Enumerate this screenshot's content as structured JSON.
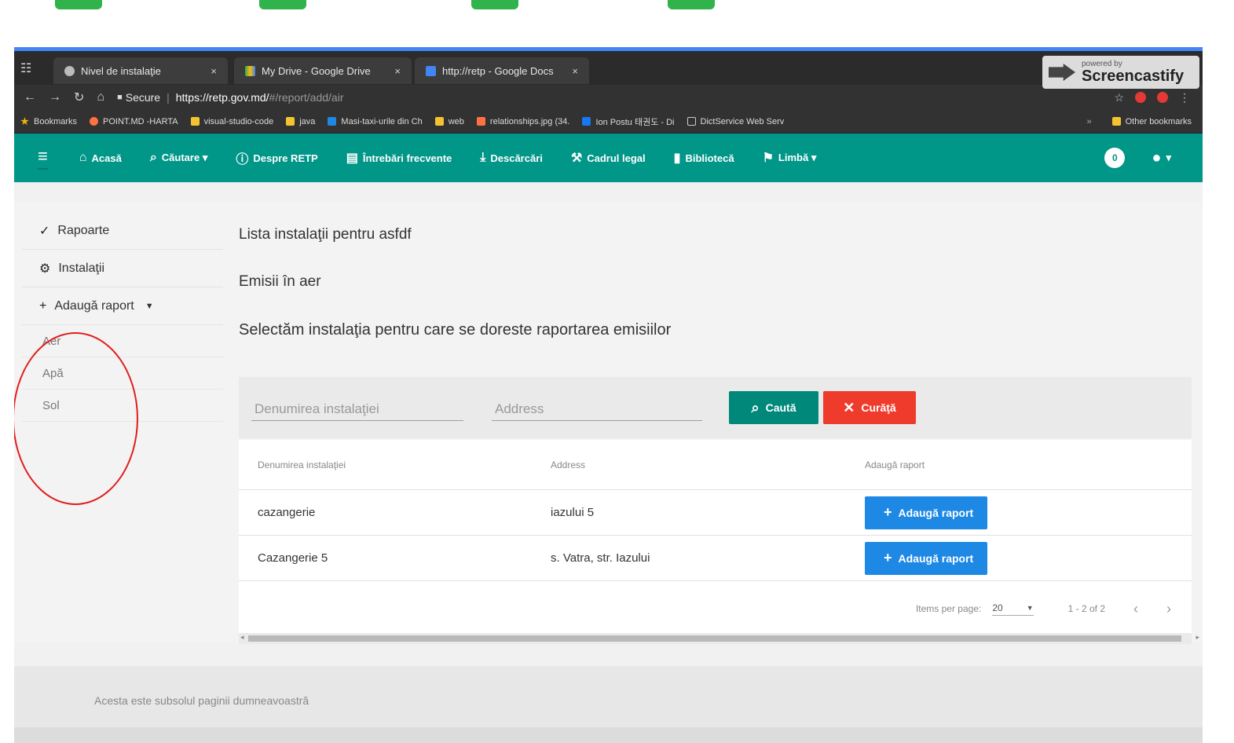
{
  "browser": {
    "tabs": [
      {
        "label": "Nivel de instalaţie",
        "close": "×"
      },
      {
        "label": "My Drive - Google Drive",
        "close": "×"
      },
      {
        "label": "http://retp - Google Docs",
        "close": "×"
      }
    ],
    "screencastify": {
      "small": "powered by",
      "big": "Screencastify"
    },
    "address": {
      "secure": "Secure",
      "host": "https://retp.gov.md/",
      "path": "#/report/add/air"
    },
    "bookmarks": [
      {
        "label": "Bookmarks",
        "color": "#f4b400"
      },
      {
        "label": "POINT.MD -HARTA",
        "color": "#ff7043"
      },
      {
        "label": "visual-studio-code",
        "color": "#f4c430"
      },
      {
        "label": "java",
        "color": "#f4c430"
      },
      {
        "label": "Masi-taxi-urile din Ch",
        "color": "#1e88e5"
      },
      {
        "label": "web",
        "color": "#f4c430"
      },
      {
        "label": "relationships.jpg (34.",
        "color": "#ff7043"
      },
      {
        "label": "Ion Postu 태권도 - Di",
        "color": "#1877f2"
      },
      {
        "label": "DictService Web Serv",
        "color": "#cccccc"
      }
    ],
    "other_bookmarks": "Other bookmarks"
  },
  "appnav": {
    "items": [
      {
        "icon": "home",
        "label": "Acasă"
      },
      {
        "icon": "search",
        "label": "Căutare ▾"
      },
      {
        "icon": "info",
        "label": "Despre RETP"
      },
      {
        "icon": "chat",
        "label": "Întrebări frecvente"
      },
      {
        "icon": "download",
        "label": "Descărcări"
      },
      {
        "icon": "gavel",
        "label": "Cadrul legal"
      },
      {
        "icon": "book",
        "label": "Bibliotecă"
      },
      {
        "icon": "flag",
        "label": "Limbă ▾"
      }
    ],
    "notifications": "0",
    "account_caret": "▾"
  },
  "sidebar": {
    "items": [
      {
        "label": "Rapoarte"
      },
      {
        "label": "Instalaţii"
      },
      {
        "label": "Adaugă raport"
      }
    ],
    "subitems": [
      "Aer",
      "Apă",
      "Sol"
    ]
  },
  "main": {
    "title": "Lista instalaţii pentru asfdf",
    "subtitle": "Emisii în aer",
    "instruction": "Selectăm instalaţia pentru care se doreste raportarea emisiilor",
    "filter": {
      "name_placeholder": "Denumirea instalaţiei",
      "address_placeholder": "Address",
      "search_label": "Caută",
      "clear_label": "Curăţă"
    },
    "table": {
      "headers": [
        "Denumirea instalaţiei",
        "Address",
        "Adaugă raport"
      ],
      "rows": [
        {
          "name": "cazangerie",
          "address": "iazului 5",
          "action": "Adaugă raport"
        },
        {
          "name": "Cazangerie 5",
          "address": "s. Vatra, str. Iazului",
          "action": "Adaugă raport"
        }
      ]
    },
    "paginator": {
      "items_per_page_label": "Items per page:",
      "items_per_page_value": "20",
      "range": "1 - 2 of 2"
    }
  },
  "footer": {
    "text": "Acesta este subsolul paginii dumneavoastră"
  }
}
